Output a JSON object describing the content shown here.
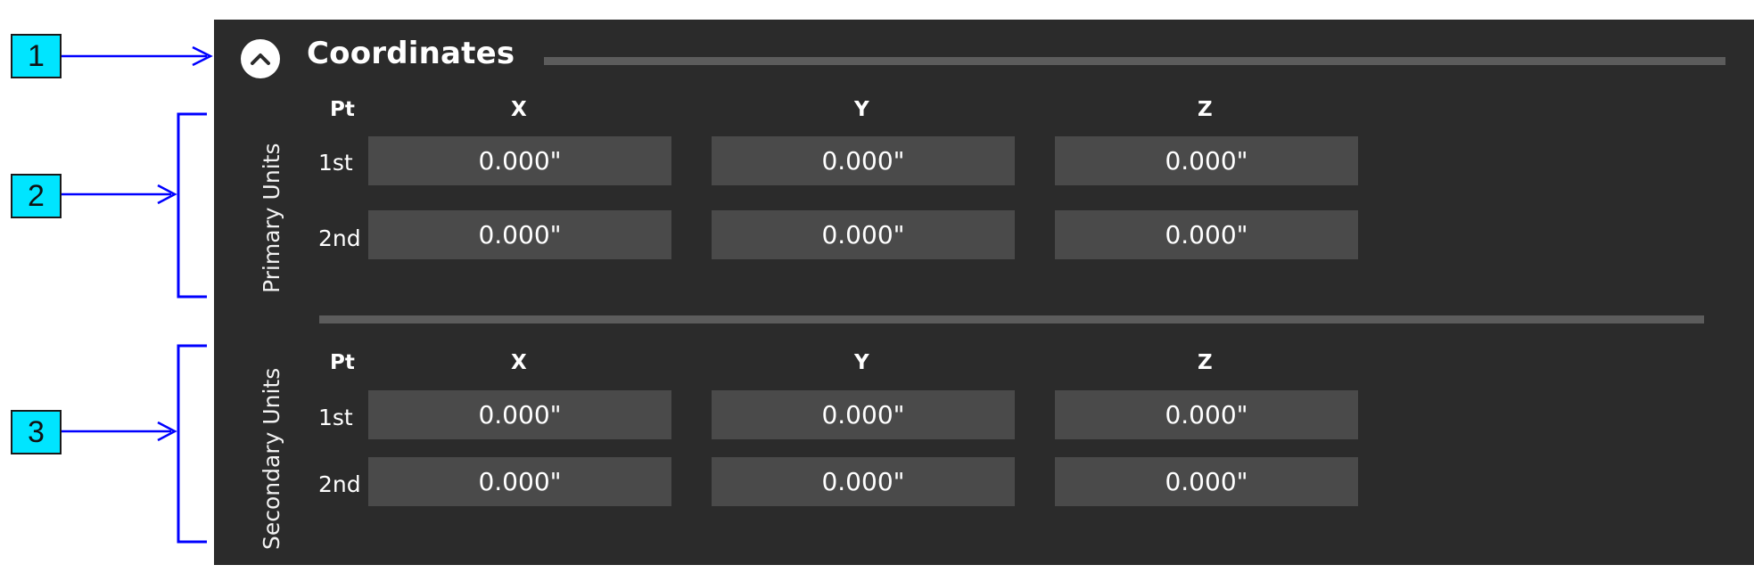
{
  "callouts": [
    "1",
    "2",
    "3"
  ],
  "panel": {
    "title": "Coordinates",
    "collapse_icon": "chevron-up-icon"
  },
  "primary": {
    "label": "Primary Units",
    "headers": {
      "pt": "Pt",
      "x": "X",
      "y": "Y",
      "z": "Z"
    },
    "rows": [
      {
        "pt": "1st",
        "x": "0.000\"",
        "y": "0.000\"",
        "z": "0.000\""
      },
      {
        "pt": "2nd",
        "x": "0.000\"",
        "y": "0.000\"",
        "z": "0.000\""
      }
    ]
  },
  "secondary": {
    "label": "Secondary Units",
    "headers": {
      "pt": "Pt",
      "x": "X",
      "y": "Y",
      "z": "Z"
    },
    "rows": [
      {
        "pt": "1st",
        "x": "0.000\"",
        "y": "0.000\"",
        "z": "0.000\""
      },
      {
        "pt": "2nd",
        "x": "0.000\"",
        "y": "0.000\"",
        "z": "0.000\""
      }
    ]
  },
  "colors": {
    "panel_bg": "#2b2b2b",
    "field_bg": "#4a4a4a",
    "rule": "#5c5c5c",
    "callout_bg": "#00e5ff",
    "arrow": "#0000ff"
  }
}
